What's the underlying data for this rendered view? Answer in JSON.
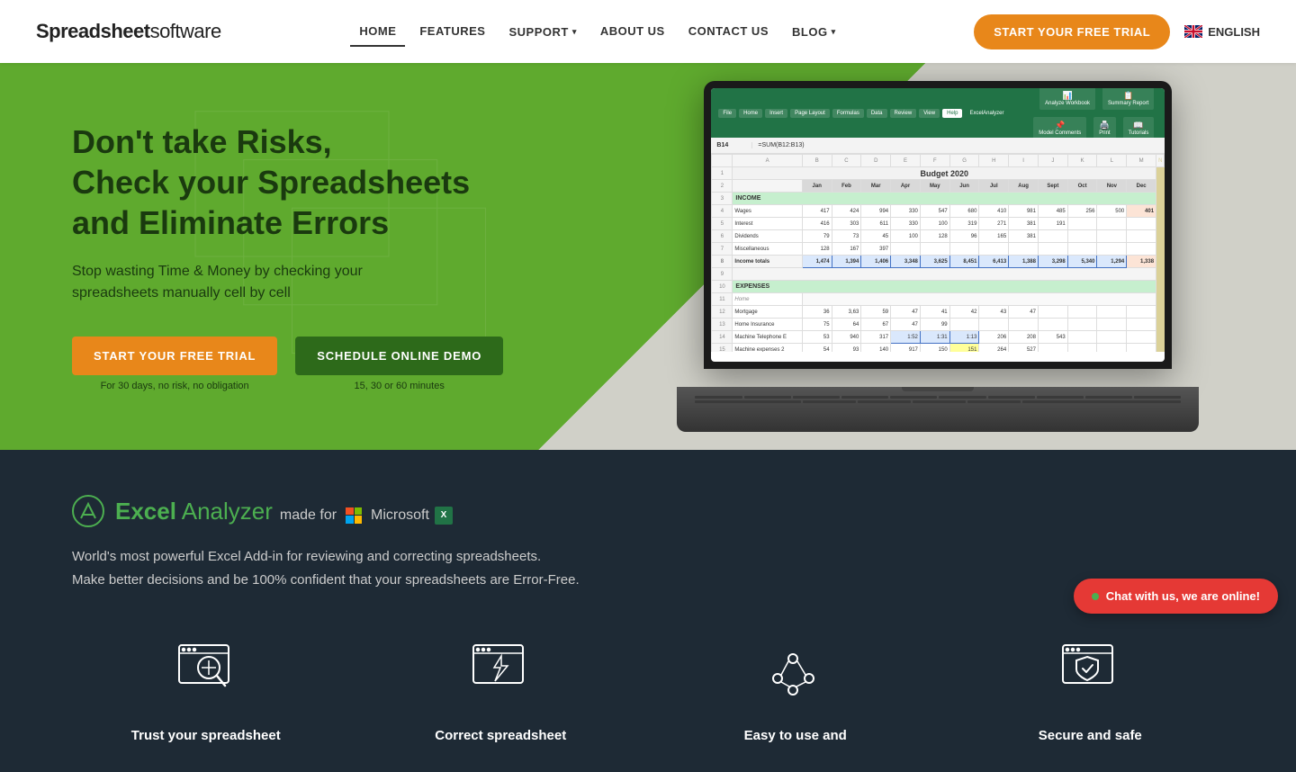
{
  "brand": {
    "name_part1": "Spreadsheet",
    "name_part2": "software"
  },
  "navbar": {
    "links": [
      {
        "label": "HOME",
        "active": true
      },
      {
        "label": "FEATURES",
        "active": false
      },
      {
        "label": "SUPPORT",
        "active": false,
        "dropdown": true
      },
      {
        "label": "ABOUT US",
        "active": false
      },
      {
        "label": "CONTACT US",
        "active": false
      },
      {
        "label": "BLOG",
        "active": false,
        "dropdown": true
      }
    ],
    "cta_label": "START YOUR FREE TRIAL",
    "lang_label": "ENGLISH"
  },
  "hero": {
    "title_line1": "Don't take Risks,",
    "title_line2": "Check your Spreadsheets",
    "title_line3": "and Eliminate Errors",
    "subtitle": "Stop wasting Time & Money by checking your\nspreadsheets manually cell by cell",
    "btn_trial": "START YOUR FREE TRIAL",
    "btn_trial_sub": "For 30 days, no risk, no obligation",
    "btn_demo": "SCHEDULE ONLINE DEMO",
    "btn_demo_sub": "15, 30 or 60 minutes"
  },
  "excel_analyzer": {
    "title": "Excel Analyzer",
    "made_for": "made for",
    "brand": "Microsoft",
    "description_line1": "World's most powerful Excel Add-in for reviewing and correcting spreadsheets.",
    "description_line2": "Make better decisions and be 100% confident that your spreadsheets are Error-Free."
  },
  "features": [
    {
      "id": "trust",
      "label": "Trust your spreadsheet",
      "icon": "magnifier"
    },
    {
      "id": "correct",
      "label": "Correct spreadsheet",
      "icon": "lightning"
    },
    {
      "id": "easy",
      "label": "Easy to use and",
      "icon": "nodes"
    },
    {
      "id": "secure",
      "label": "Secure and safe",
      "icon": "shield"
    }
  ],
  "chat": {
    "dot_color": "#4caf50",
    "label": "Chat with us, we are online!"
  }
}
